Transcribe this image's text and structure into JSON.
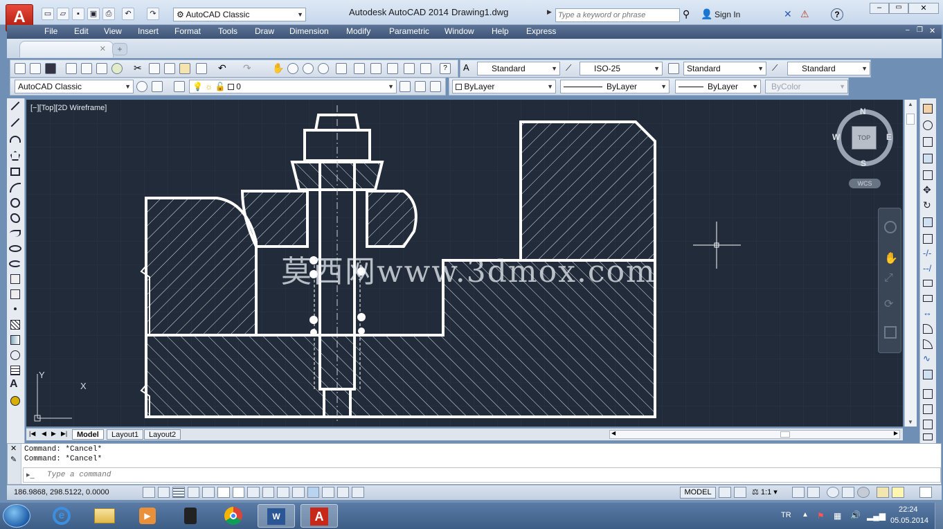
{
  "window": {
    "app_logo": "A",
    "workspace_combo": "AutoCAD Classic",
    "app_title": "Autodesk AutoCAD 2014",
    "doc_title": "Drawing1.dwg",
    "search_placeholder": "Type a keyword or phrase",
    "sign_in": "Sign In",
    "help": "?"
  },
  "menu": [
    "File",
    "Edit",
    "View",
    "Insert",
    "Format",
    "Tools",
    "Draw",
    "Dimension",
    "Modify",
    "Parametric",
    "Window",
    "Help",
    "Express"
  ],
  "toolbar": {
    "text_style": "Standard",
    "dim_style": "ISO-25",
    "table_style": "Standard",
    "mleader_style": "Standard",
    "workspace": "AutoCAD Classic",
    "layer": "0",
    "color": "ByLayer",
    "linetype": "ByLayer",
    "lineweight": "ByLayer",
    "plotstyle": "ByColor"
  },
  "viewport": {
    "label": "[−][Top][2D Wireframe]",
    "compass": {
      "n": "N",
      "s": "S",
      "e": "E",
      "w": "W",
      "center": "TOP",
      "ucs": "WCS"
    },
    "watermark": "莫西网www.3dmox.com",
    "ucs_x": "X",
    "ucs_y": "Y"
  },
  "layout_tabs": [
    "Model",
    "Layout1",
    "Layout2"
  ],
  "command": {
    "history": [
      "Command: *Cancel*",
      "Command: *Cancel*"
    ],
    "placeholder": "Type a command"
  },
  "status": {
    "coords": "186.9868, 298.5122, 0.0000",
    "model": "MODEL",
    "scale": "1:1"
  },
  "taskbar": {
    "lang": "TR",
    "time": "22:24",
    "date": "05.05.2014"
  },
  "colors": {
    "canvas": "#222b39",
    "menubar": "#4a6184",
    "accent_red": "#c8281a"
  }
}
